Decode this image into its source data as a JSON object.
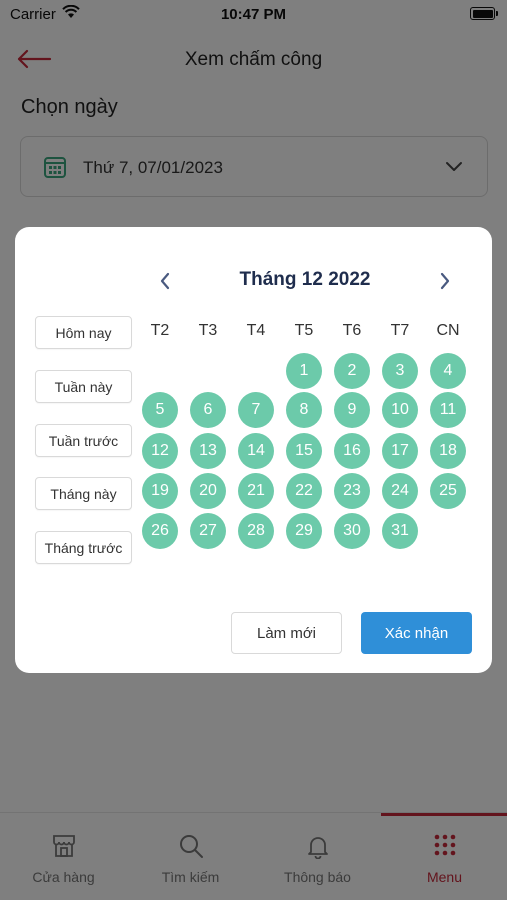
{
  "status_bar": {
    "carrier": "Carrier",
    "time": "10:47 PM"
  },
  "header": {
    "title": "Xem chấm công",
    "back_icon": "arrow-left-icon",
    "accent": "#c6283a"
  },
  "date_picker": {
    "label": "Chọn ngày",
    "value": "Thứ 7, 07/01/2023"
  },
  "calendar": {
    "month_title": "Tháng 12 2022",
    "weekdays": [
      "T2",
      "T3",
      "T4",
      "T5",
      "T6",
      "T7",
      "CN"
    ],
    "first_day_col": 3,
    "days": [
      1,
      2,
      3,
      4,
      5,
      6,
      7,
      8,
      9,
      10,
      11,
      12,
      13,
      14,
      15,
      16,
      17,
      18,
      19,
      20,
      21,
      22,
      23,
      24,
      25,
      26,
      27,
      28,
      29,
      30,
      31
    ],
    "day_color": "#6ccaaa",
    "quick_ranges": [
      "Hôm nay",
      "Tuần này",
      "Tuần trước",
      "Tháng này",
      "Tháng trước"
    ],
    "reset_label": "Làm mới",
    "confirm_label": "Xác nhận",
    "confirm_color": "#2f8fd8"
  },
  "tab_bar": {
    "tabs": [
      {
        "label": "Cửa hàng",
        "icon": "store-icon",
        "active": false
      },
      {
        "label": "Tìm kiếm",
        "icon": "search-icon",
        "active": false
      },
      {
        "label": "Thông báo",
        "icon": "bell-icon",
        "active": false
      },
      {
        "label": "Menu",
        "icon": "grid-dots-icon",
        "active": true
      }
    ]
  }
}
